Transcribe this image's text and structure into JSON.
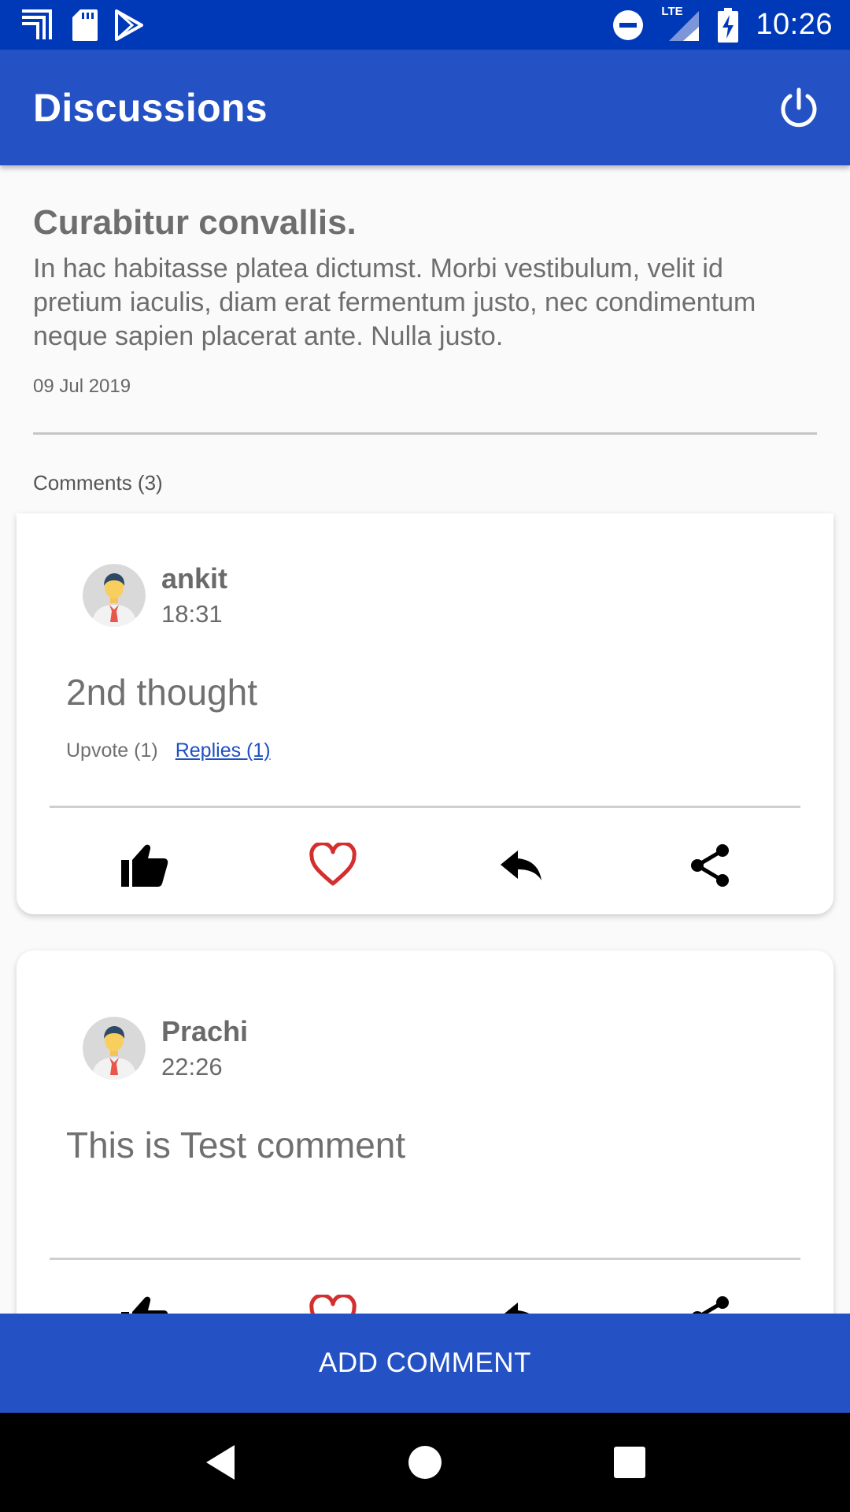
{
  "status_bar": {
    "time": "10:26",
    "icons_left": [
      "cast-icon",
      "sd-card-icon",
      "play-store-icon"
    ],
    "icons_right": [
      "do-not-disturb-icon",
      "lte-signal-icon",
      "battery-charging-icon"
    ],
    "lte_label": "LTE"
  },
  "app_bar": {
    "title": "Discussions",
    "action_icon": "power-icon"
  },
  "post": {
    "title": "Curabitur convallis.",
    "body": "In hac habitasse platea dictumst. Morbi vestibulum, velit id pretium iaculis, diam erat fermentum justo, nec condimentum neque sapien placerat ante. Nulla justo.",
    "date": "09 Jul 2019"
  },
  "comments_label": "Comments (3)",
  "comments": [
    {
      "author": "ankit",
      "time": "18:31",
      "text": "2nd thought",
      "upvote": "Upvote (1)",
      "replies": "Replies (1)"
    },
    {
      "author": "Prachi",
      "time": "22:26",
      "text": "This is Test comment"
    }
  ],
  "add_comment_label": "ADD COMMENT",
  "colors": {
    "status_bar": "#0039b8",
    "primary": "#2452c4",
    "heart": "#d32f2f",
    "link": "#1f4fc2"
  }
}
